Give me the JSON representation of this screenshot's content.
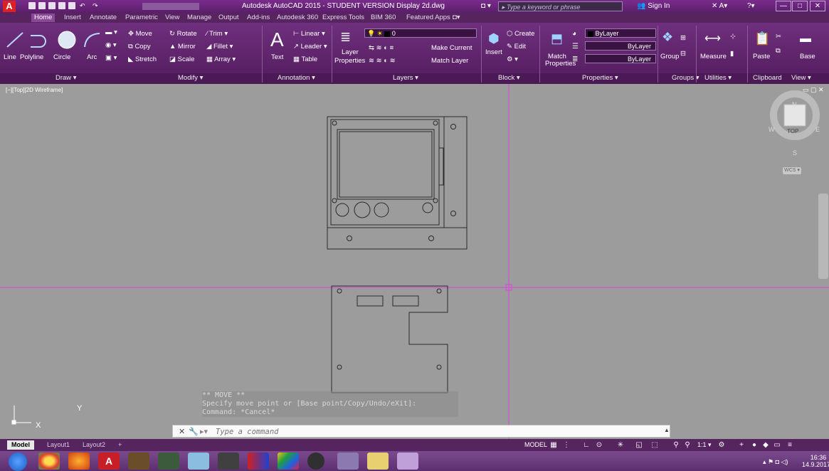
{
  "window": {
    "title": "Autodesk AutoCAD 2015 - STUDENT VERSION   Display 2d.dwg",
    "search_placeholder": "Type a keyword or phrase",
    "sign_in": "Sign In"
  },
  "tabs": [
    "Home",
    "Insert",
    "Annotate",
    "Parametric",
    "View",
    "Manage",
    "Output",
    "Add-ins",
    "Autodesk 360",
    "Express Tools",
    "BIM 360",
    "Featured Apps"
  ],
  "ribbon": {
    "draw": {
      "title": "Draw ▾",
      "line": "Line",
      "polyline": "Polyline",
      "circle": "Circle",
      "arc": "Arc"
    },
    "modify": {
      "title": "Modify ▾",
      "move": "Move",
      "rotate": "Rotate",
      "trim": "Trim ▾",
      "copy": "Copy",
      "mirror": "Mirror",
      "fillet": "Fillet ▾",
      "stretch": "Stretch",
      "scale": "Scale",
      "array": "Array ▾"
    },
    "annotation": {
      "title": "Annotation ▾",
      "text": "Text",
      "linear": "Linear ▾",
      "leader": "Leader ▾",
      "table": "Table"
    },
    "layers": {
      "title": "Layers ▾",
      "layer_properties_1": "Layer",
      "layer_properties_2": "Properties",
      "current_layer": "0",
      "make_current": "Make Current",
      "match_layer": "Match Layer"
    },
    "block": {
      "title": "Block ▾",
      "insert": "Insert",
      "create": "Create",
      "edit": "Edit"
    },
    "properties": {
      "title": "Properties ▾",
      "match_1": "Match",
      "match_2": "Properties",
      "color": "ByLayer",
      "linetype": "ByLayer",
      "lineweight": "ByLayer"
    },
    "groups": {
      "title": "Groups ▾",
      "group": "Group"
    },
    "utilities": {
      "title": "Utilities ▾",
      "measure": "Measure"
    },
    "clipboard": {
      "title": "Clipboard",
      "paste": "Paste"
    },
    "view": {
      "title": "View ▾",
      "base": "Base"
    }
  },
  "viewport_label": "[−][Top][2D Wireframe]",
  "viewcube": {
    "top": "TOP",
    "n": "N",
    "s": "S",
    "w": "W",
    "e": "E",
    "wcs": "WCS ▾"
  },
  "ucs": {
    "x": "X",
    "y": "Y"
  },
  "command_history": [
    "** MOVE **",
    "Specify move point or [Base point/Copy/Undo/eXit]:",
    "Command: *Cancel*"
  ],
  "command_placeholder": "Type a command",
  "layout_tabs": [
    "Model",
    "Layout1",
    "Layout2",
    "+"
  ],
  "status": {
    "model": "MODEL",
    "scale": "1:1 ▾"
  },
  "clock": {
    "time": "16:36",
    "date": "14.9.2017"
  }
}
